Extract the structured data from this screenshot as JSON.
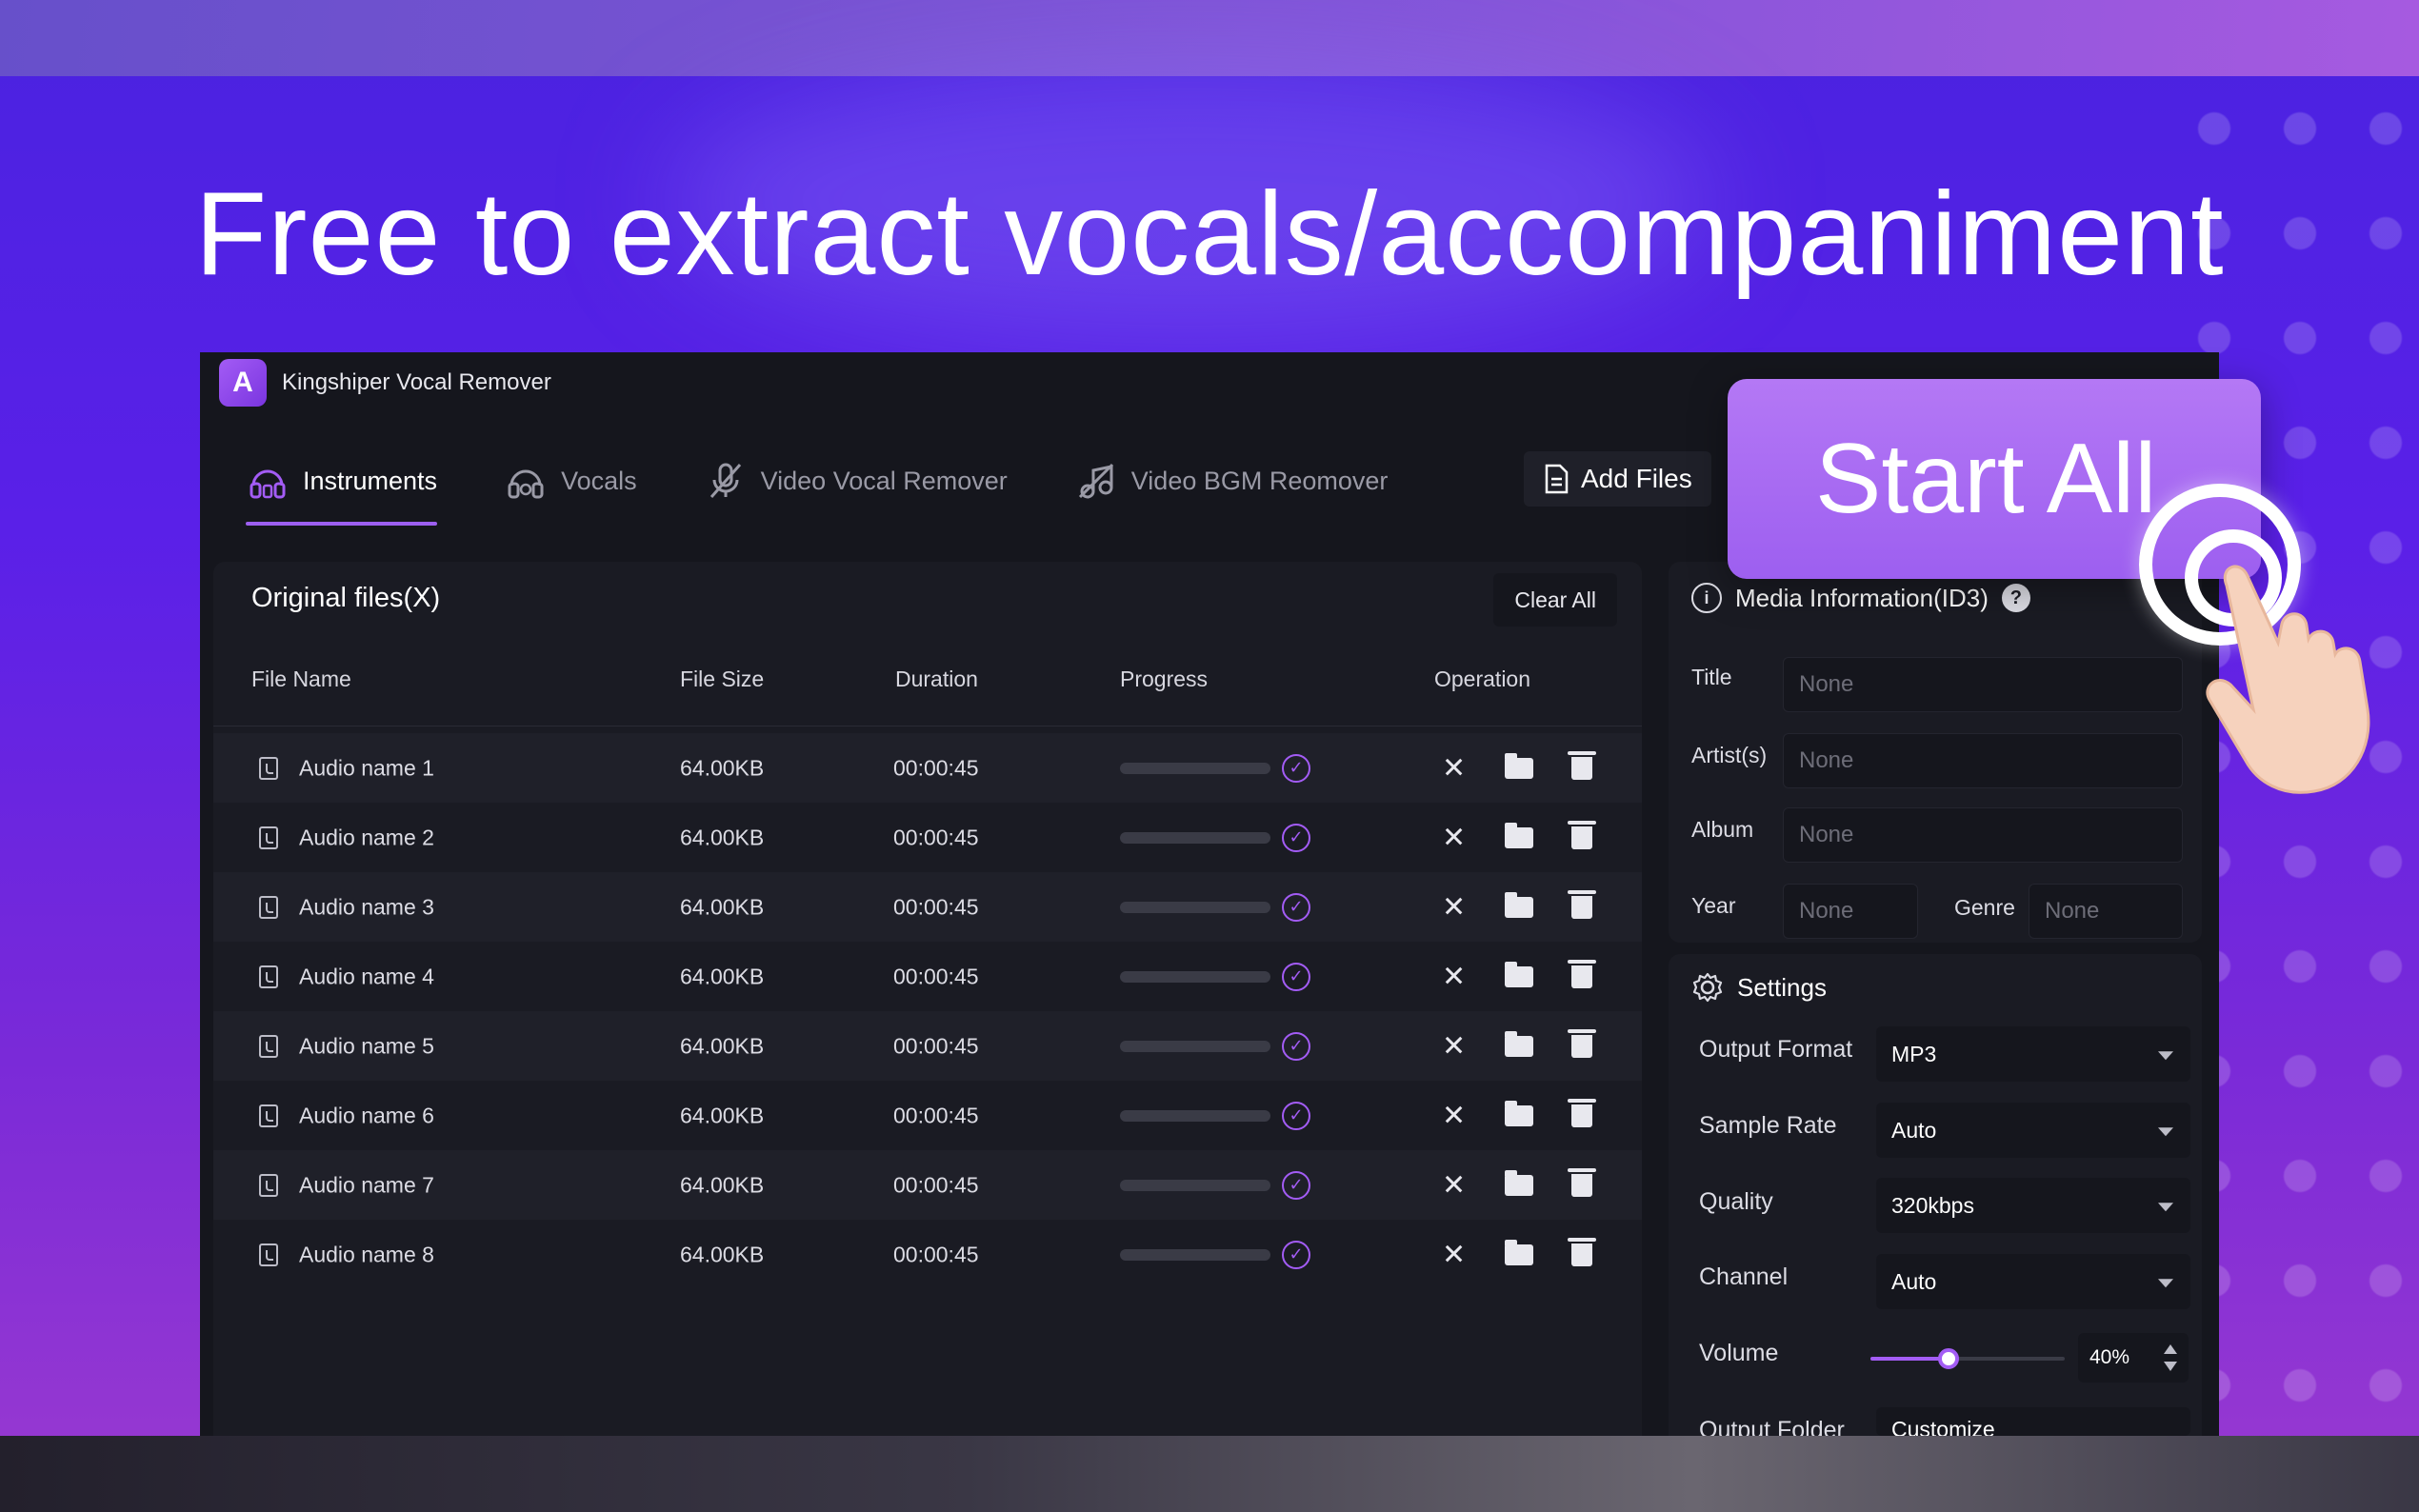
{
  "headline": "Free to extract vocals/accompaniment",
  "app": {
    "title": "Kingshiper Vocal Remover",
    "logo_letter": "A"
  },
  "tabs": [
    {
      "label": "Instruments",
      "icon": "headphones-icon",
      "active": true
    },
    {
      "label": "Vocals",
      "icon": "headphones-mic-icon",
      "active": false
    },
    {
      "label": "Video Vocal Remover",
      "icon": "mic-off-icon",
      "active": false
    },
    {
      "label": "Video BGM Reomover",
      "icon": "music-note-off-icon",
      "active": false
    }
  ],
  "toolbar": {
    "add_files": "Add Files",
    "start_all": "Start All"
  },
  "files": {
    "title": "Original files(X)",
    "clear_all": "Clear All",
    "columns": {
      "name": "File Name",
      "size": "File Size",
      "duration": "Duration",
      "progress": "Progress",
      "operation": "Operation"
    },
    "rows": [
      {
        "name": "Audio name 1",
        "size": "64.00KB",
        "duration": "00:00:45",
        "progress": 1.0
      },
      {
        "name": "Audio name 2",
        "size": "64.00KB",
        "duration": "00:00:45",
        "progress": 1.0
      },
      {
        "name": "Audio name 3",
        "size": "64.00KB",
        "duration": "00:00:45",
        "progress": 1.0
      },
      {
        "name": "Audio name 4",
        "size": "64.00KB",
        "duration": "00:00:45",
        "progress": 1.0
      },
      {
        "name": "Audio name 5",
        "size": "64.00KB",
        "duration": "00:00:45",
        "progress": 1.0
      },
      {
        "name": "Audio name 6",
        "size": "64.00KB",
        "duration": "00:00:45",
        "progress": 1.0
      },
      {
        "name": "Audio name 7",
        "size": "64.00KB",
        "duration": "00:00:45",
        "progress": 1.0
      },
      {
        "name": "Audio name 8",
        "size": "64.00KB",
        "duration": "00:00:45",
        "progress": 1.0
      }
    ]
  },
  "media_info": {
    "title": "Media Information(ID3)",
    "title_label": "Title",
    "title_value": "None",
    "artist_label": "Artist(s)",
    "artist_value": "None",
    "album_label": "Album",
    "album_value": "None",
    "year_label": "Year",
    "year_value": "None",
    "genre_label": "Genre",
    "genre_value": "None"
  },
  "settings": {
    "title": "Settings",
    "output_format_label": "Output Format",
    "output_format": "MP3",
    "sample_rate_label": "Sample Rate",
    "sample_rate": "Auto",
    "quality_label": "Quality",
    "quality": "320kbps",
    "channel_label": "Channel",
    "channel": "Auto",
    "volume_label": "Volume",
    "volume": "40%",
    "volume_level": 0.4,
    "output_folder_label": "Output Folder",
    "output_folder": "Customize"
  },
  "colors": {
    "accent": "#a35cf5",
    "window_bg": "#15161d",
    "panel_bg": "#1a1b23"
  }
}
